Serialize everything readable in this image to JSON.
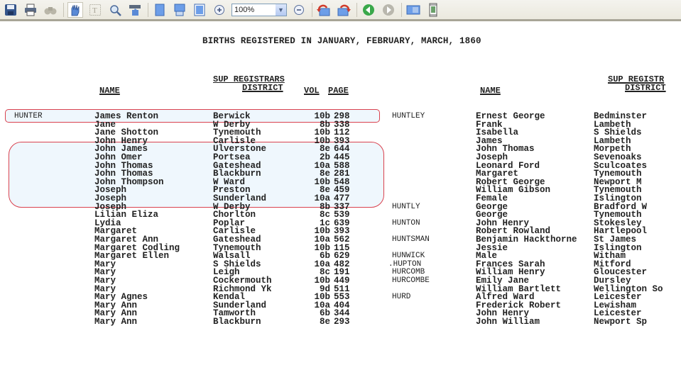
{
  "toolbar": {
    "icons": [
      "save-icon",
      "print-icon",
      "find-icon",
      "hand-tool-icon",
      "text-select-icon",
      "zoom-select-icon",
      "marquee-zoom-icon",
      "single-page-icon",
      "continuous-page-icon",
      "facing-page-icon",
      "zoom-in-icon",
      "zoom-out-icon",
      "rotate-left-icon",
      "rotate-right-icon",
      "previous-page-icon",
      "next-page-icon",
      "fit-width-icon",
      "fit-page-icon"
    ],
    "zoom_value": "100%"
  },
  "document": {
    "title": "BIRTHS REGISTERED IN JANUARY, FEBRUARY, MARCH, 1860",
    "left_headers": {
      "name": "NAME",
      "district_line1": "SUP REGISTRARS",
      "district_line2": "DISTRICT",
      "vol": "VOL",
      "page": "PAGE"
    },
    "right_headers": {
      "name": "NAME",
      "district_line1": "SUP REGISTR",
      "district_line2": "DISTRICT"
    },
    "left_rows": [
      {
        "surname": "HUNTER",
        "name": "James Renton",
        "district": "Berwick",
        "vol": "10b",
        "page": "298"
      },
      {
        "surname": "",
        "name": "Jane",
        "district": "W Derby",
        "vol": "8b",
        "page": "338"
      },
      {
        "surname": "",
        "name": "Jane Shotton",
        "district": "Tynemouth",
        "vol": "10b",
        "page": "112"
      },
      {
        "surname": "",
        "name": "John Henry",
        "district": "Carlisle",
        "vol": "10b",
        "page": "393"
      },
      {
        "surname": "",
        "name": "John James",
        "district": "Ulverstone",
        "vol": "8e",
        "page": "644"
      },
      {
        "surname": "",
        "name": "John Omer",
        "district": "Portsea",
        "vol": "2b",
        "page": "445"
      },
      {
        "surname": "",
        "name": "John Thomas",
        "district": "Gateshead",
        "vol": "10a",
        "page": "588"
      },
      {
        "surname": "",
        "name": "John Thomas",
        "district": "Blackburn",
        "vol": "8e",
        "page": "281"
      },
      {
        "surname": "",
        "name": "John Thompson",
        "district": "W Ward",
        "vol": "10b",
        "page": "548"
      },
      {
        "surname": "",
        "name": "Joseph",
        "district": "Preston",
        "vol": "8e",
        "page": "459"
      },
      {
        "surname": "",
        "name": "Joseph",
        "district": "Sunderland",
        "vol": "10a",
        "page": "477"
      },
      {
        "surname": "",
        "name": "Joseph",
        "district": "W Derby",
        "vol": "8b",
        "page": "337"
      },
      {
        "surname": "",
        "name": "Lilian Eliza",
        "district": "Chorlton",
        "vol": "8c",
        "page": "539"
      },
      {
        "surname": "",
        "name": "Lydia",
        "district": "Poplar",
        "vol": "1c",
        "page": "639"
      },
      {
        "surname": "",
        "name": "Margaret",
        "district": "Carlisle",
        "vol": "10b",
        "page": "393"
      },
      {
        "surname": "",
        "name": "Margaret Ann",
        "district": "Gateshead",
        "vol": "10a",
        "page": "562"
      },
      {
        "surname": "",
        "name": "Margaret Codling",
        "district": "Tynemouth",
        "vol": "10b",
        "page": "115"
      },
      {
        "surname": "",
        "name": "Margaret Ellen",
        "district": "Walsall",
        "vol": "6b",
        "page": "629"
      },
      {
        "surname": "",
        "name": "Mary",
        "district": "S Shields",
        "vol": "10a",
        "page": "482"
      },
      {
        "surname": "",
        "name": "Mary",
        "district": "Leigh",
        "vol": "8c",
        "page": "191"
      },
      {
        "surname": "",
        "name": "Mary",
        "district": "Cockermouth",
        "vol": "10b",
        "page": "449"
      },
      {
        "surname": "",
        "name": "Mary",
        "district": "Richmond Yk",
        "vol": "9d",
        "page": "511"
      },
      {
        "surname": "",
        "name": "Mary Agnes",
        "district": "Kendal",
        "vol": "10b",
        "page": "553"
      },
      {
        "surname": "",
        "name": "Mary Ann",
        "district": "Sunderland",
        "vol": "10a",
        "page": "404"
      },
      {
        "surname": "",
        "name": "Mary Ann",
        "district": "Tamworth",
        "vol": "6b",
        "page": "344"
      },
      {
        "surname": "",
        "name": "Mary Ann",
        "district": "Blackburn",
        "vol": "8e",
        "page": "293"
      }
    ],
    "right_rows": [
      {
        "surname": "HUNTLEY",
        "name": "Ernest George",
        "district": "Bedminster"
      },
      {
        "surname": "",
        "name": "Frank",
        "district": "Lambeth"
      },
      {
        "surname": "",
        "name": "Isabella",
        "district": "S Shields"
      },
      {
        "surname": "",
        "name": "James",
        "district": "Lambeth"
      },
      {
        "surname": "",
        "name": "John Thomas",
        "district": "Morpeth"
      },
      {
        "surname": "",
        "name": "Joseph",
        "district": "Sevenoaks"
      },
      {
        "surname": "",
        "name": "Leonard Ford",
        "district": "Sculcoates"
      },
      {
        "surname": "",
        "name": "Margaret",
        "district": "Tynemouth"
      },
      {
        "surname": "",
        "name": "Robert George",
        "district": "Newport M"
      },
      {
        "surname": "",
        "name": "William Gibson",
        "district": "Tynemouth"
      },
      {
        "surname": "",
        "name": "Female",
        "district": "Islington"
      },
      {
        "surname": "HUNTLY",
        "name": "George",
        "district": "Bradford W"
      },
      {
        "surname": "",
        "name": "George",
        "district": "Tynemouth"
      },
      {
        "surname": "HUNTON",
        "name": "John Henry",
        "district": "Stokesley"
      },
      {
        "surname": "",
        "name": "Robert Rowland",
        "district": "Hartlepool"
      },
      {
        "surname": "HUNTSMAN",
        "name": "Benjamin Hackthorne",
        "district": "St James"
      },
      {
        "surname": "",
        "name": "Jessie",
        "district": "Islington"
      },
      {
        "surname": "HUNWICK",
        "name": "Male",
        "district": "Witham"
      },
      {
        "surname": ".HUPTON",
        "name": "Frances Sarah",
        "district": "Mitford"
      },
      {
        "surname": "HURCOMB",
        "name": "William Henry",
        "district": "Gloucester"
      },
      {
        "surname": "HURCOMBE",
        "name": "Emily Jane",
        "district": "Dursley"
      },
      {
        "surname": "",
        "name": "William Bartlett",
        "district": "Wellington So"
      },
      {
        "surname": "HURD",
        "name": "Alfred Ward",
        "district": "Leicester"
      },
      {
        "surname": "",
        "name": "Frederick Robert",
        "district": "Lewisham"
      },
      {
        "surname": "",
        "name": "John Henry",
        "district": "Leicester"
      },
      {
        "surname": "",
        "name": "John William",
        "district": "Newport Sp"
      }
    ],
    "highlights": {
      "color": "#d9424f"
    }
  }
}
